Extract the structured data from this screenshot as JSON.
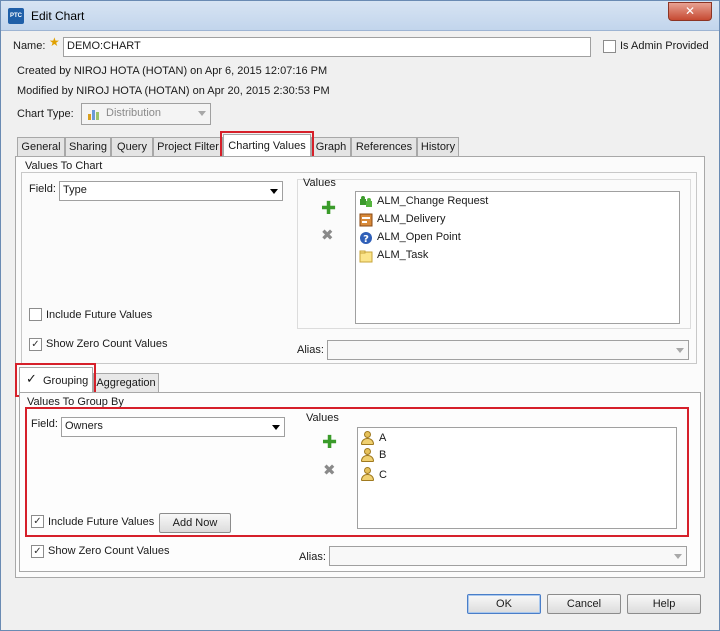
{
  "window": {
    "title": "Edit Chart",
    "logo_text": "PTC",
    "close_glyph": "✕"
  },
  "header": {
    "name_label": "Name:",
    "name_value": "DEMO:CHART",
    "admin_label": "Is Admin Provided",
    "created_text": "Created by NIROJ HOTA (HOTAN) on Apr 6, 2015 12:07:16 PM",
    "modified_text": "Modified by NIROJ HOTA (HOTAN) on Apr 20, 2015 2:30:53 PM",
    "chart_type_label": "Chart Type:",
    "chart_type_value": "Distribution"
  },
  "tabs": [
    {
      "label": "General"
    },
    {
      "label": "Sharing"
    },
    {
      "label": "Query"
    },
    {
      "label": "Project Filter"
    },
    {
      "label": "Charting Values"
    },
    {
      "label": "Graph"
    },
    {
      "label": "References"
    },
    {
      "label": "History"
    }
  ],
  "values_to_chart": {
    "title": "Values To Chart",
    "field_label": "Field:",
    "field_value": "Type",
    "values_label": "Values",
    "items": [
      {
        "label": "ALM_Change Request",
        "icon": "puzzle-icon"
      },
      {
        "label": "ALM_Delivery",
        "icon": "delivery-icon"
      },
      {
        "label": "ALM_Open Point",
        "icon": "question-icon"
      },
      {
        "label": "ALM_Task",
        "icon": "folder-icon"
      }
    ],
    "include_future_label": "Include Future Values",
    "show_zero_label": "Show Zero Count Values",
    "show_zero_check": "✓",
    "alias_label": "Alias:",
    "alias_value": ""
  },
  "subtabs": [
    {
      "label": "Grouping",
      "check": "✓"
    },
    {
      "label": "Aggregation"
    }
  ],
  "grouping": {
    "title": "Values To Group By",
    "field_label": "Field:",
    "field_value": "Owners",
    "values_label": "Values",
    "items": [
      {
        "label": "A"
      },
      {
        "label": "B"
      },
      {
        "label": "C"
      }
    ],
    "include_future_label": "Include Future Values",
    "include_future_check": "✓",
    "add_now_label": "Add Now",
    "show_zero_label": "Show Zero Count Values",
    "show_zero_check": "✓",
    "alias_label": "Alias:",
    "alias_value": ""
  },
  "footer": {
    "ok_label": "OK",
    "cancel_label": "Cancel",
    "help_label": "Help"
  },
  "colors": {
    "highlight": "#d6202a",
    "add": "#3a9b2a"
  }
}
